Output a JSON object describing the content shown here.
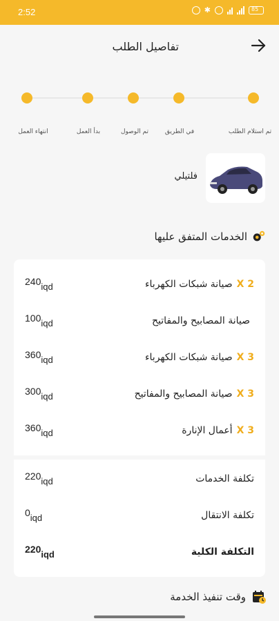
{
  "status_bar": {
    "time": "2:52",
    "battery": "85"
  },
  "header": {
    "title": "تفاصيل الطلب"
  },
  "progress": {
    "steps": [
      "تم استلام الطلب",
      "في الطريق",
      "تم الوصول",
      "بدأ العمل",
      "انتهاء العمل"
    ]
  },
  "vehicle": {
    "name": "فلتيلي"
  },
  "services": {
    "title": "الخدمات المتفق عليها",
    "currency": "iqd",
    "items": [
      {
        "name": "صيانة شبكات الكهرباء",
        "qty": "X 2",
        "price": "240"
      },
      {
        "name": "صيانة المصابيح والمفاتيح",
        "qty": "",
        "price": "100"
      },
      {
        "name": "صيانة شبكات الكهرباء",
        "qty": "X 3",
        "price": "360"
      },
      {
        "name": "صيانة المصابيح والمفاتيح",
        "qty": "X 3",
        "price": "300"
      },
      {
        "name": "أعمال الإنارة",
        "qty": "X 3",
        "price": "360"
      }
    ],
    "summary": [
      {
        "label": "تكلفة الخدمات",
        "value": "220"
      },
      {
        "label": "تكلفة الانتقال",
        "value": "0"
      },
      {
        "label": "التكلفة الكلية",
        "value": "220"
      }
    ]
  },
  "execution_time": {
    "title": "وقت تنفيذ الخدمة"
  },
  "colors": {
    "accent": "#f5b92a",
    "quantity": "#f0ad1c"
  }
}
